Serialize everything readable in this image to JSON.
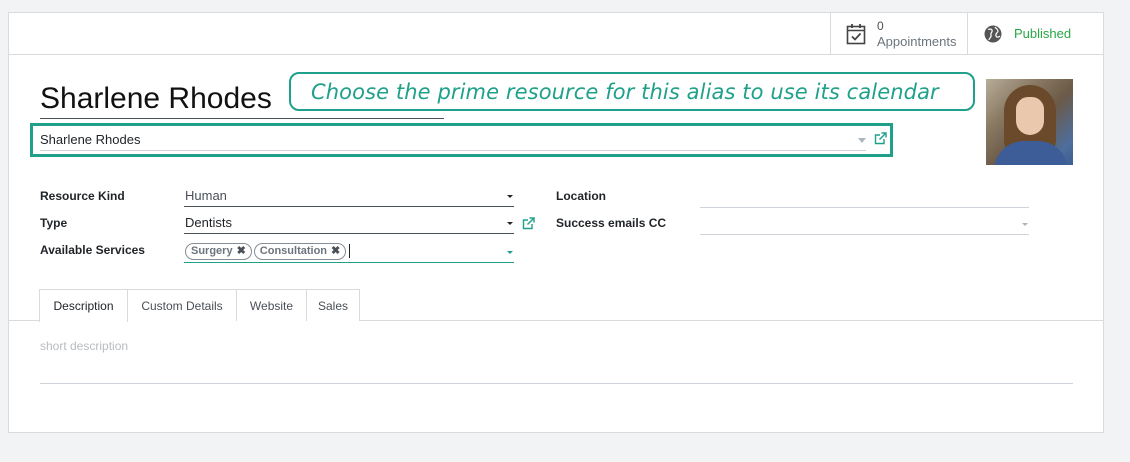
{
  "button_box": {
    "appointments": {
      "value": "0",
      "label": "Appointments",
      "icon": "calendar-check-icon"
    },
    "published": {
      "label": "Published",
      "icon": "globe-icon",
      "color": "#28a745"
    }
  },
  "record": {
    "name": "Sharlene Rhodes",
    "resource": "Sharlene Rhodes"
  },
  "tooltip": {
    "text": "Choose the prime resource for this alias to use its calendar",
    "color": "#1fa08b"
  },
  "fields": {
    "resource_kind": {
      "label": "Resource Kind",
      "value": "Human"
    },
    "type": {
      "label": "Type",
      "value": "Dentists"
    },
    "available_services": {
      "label": "Available Services",
      "tags": [
        "Surgery",
        "Consultation"
      ]
    },
    "location": {
      "label": "Location",
      "value": ""
    },
    "success_emails_cc": {
      "label": "Success emails CC",
      "value": ""
    }
  },
  "tabs": [
    {
      "label": "Description",
      "active": true
    },
    {
      "label": "Custom Details",
      "active": false
    },
    {
      "label": "Website",
      "active": false
    },
    {
      "label": "Sales",
      "active": false
    }
  ],
  "description": {
    "placeholder": "short description"
  }
}
